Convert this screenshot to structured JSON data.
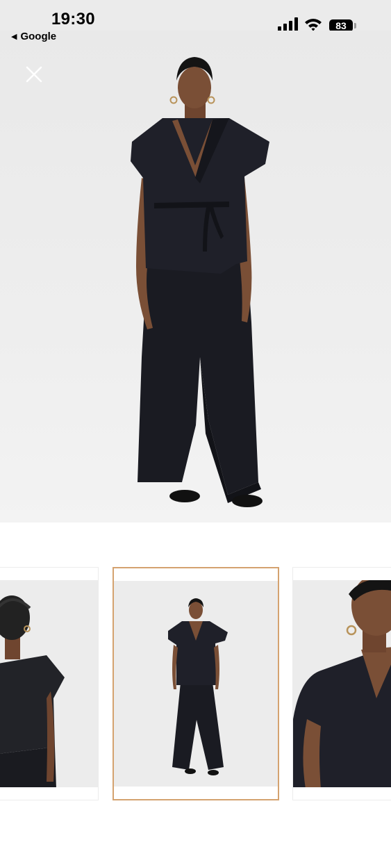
{
  "status_bar": {
    "time": "19:30",
    "back_app": "Google",
    "battery": "83",
    "icons": [
      "cellular-signal-icon",
      "wifi-icon",
      "battery-icon"
    ]
  },
  "viewer": {
    "close_icon": "close-icon",
    "main_image_alt": "Model wearing black sleeveless wrap top and wide-leg trousers",
    "thumbnails": [
      {
        "alt": "Back view of black wrap top",
        "selected": false
      },
      {
        "alt": "Full-length front view of black outfit",
        "selected": true
      },
      {
        "alt": "Close-up of black wrap top neckline",
        "selected": false
      }
    ]
  },
  "colors": {
    "selected_border": "#d4a26f",
    "garment": "#1a1b22",
    "skin": "#7a4f36",
    "background": "#ececec"
  }
}
